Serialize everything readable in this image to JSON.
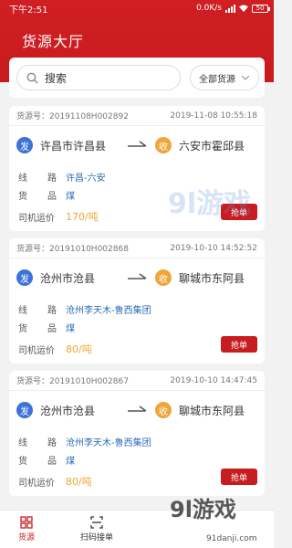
{
  "status_bar": {
    "time": "下午2:51",
    "speed": "0.0K/s",
    "battery": "50"
  },
  "header": {
    "title": "货源大厅"
  },
  "search": {
    "placeholder": "搜索",
    "filter_label": "全部货源"
  },
  "labels": {
    "route": [
      "线",
      "路"
    ],
    "goods": [
      "货",
      "品"
    ],
    "price": "司机运价",
    "grab": "抢单",
    "from_badge": "发",
    "to_badge": "收"
  },
  "cards": [
    {
      "number": "货源号：20191108H002892",
      "time": "2019-11-08 10:55:18",
      "from": "许昌市许昌县",
      "to": "六安市霍邱县",
      "route": "许昌-六安",
      "goods": "煤",
      "price": "170/吨"
    },
    {
      "number": "货源号：20191010H002868",
      "time": "2019-10-10 14:52:52",
      "from": "沧州市沧县",
      "to": "聊城市东阿县",
      "route": "沧州李天木-鲁西集团",
      "goods": "煤",
      "price": "80/吨"
    },
    {
      "number": "货源号：20191010H002867",
      "time": "2019-10-10 14:47:45",
      "from": "沧州市沧县",
      "to": "聊城市东阿县",
      "route": "沧州李天木-鲁西集团",
      "goods": "煤",
      "price": "80/吨"
    }
  ],
  "bottom_nav": [
    {
      "label": "货源",
      "icon": "grid-icon",
      "active": true
    },
    {
      "label": "扫码接单",
      "icon": "scan-icon",
      "active": false
    }
  ],
  "watermark": {
    "brand": "9l游戏",
    "site": "91danji.com"
  },
  "colors": {
    "primary": "#c81d20",
    "link": "#2a6db5",
    "price": "#f0a53a",
    "from_badge": "#3b73d8",
    "to_badge": "#f0a53a"
  }
}
